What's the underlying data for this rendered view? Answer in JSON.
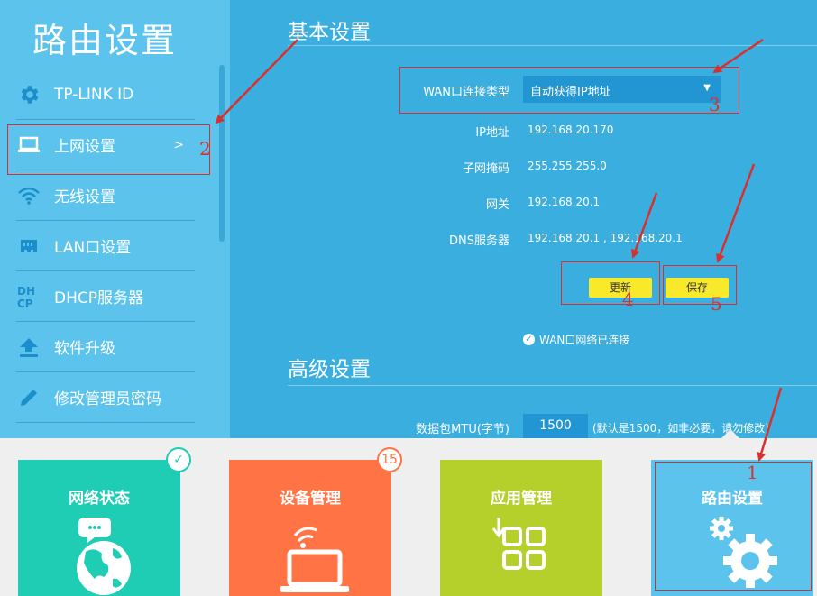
{
  "sidebar": {
    "title": "路由设置",
    "items": [
      {
        "label": "TP-LINK ID",
        "icon": "gear-icon"
      },
      {
        "label": "上网设置",
        "icon": "laptop-icon",
        "chevron": ">"
      },
      {
        "label": "无线设置",
        "icon": "wifi-icon"
      },
      {
        "label": "LAN口设置",
        "icon": "lan-port-icon"
      },
      {
        "label": "DHCP服务器",
        "icon": "dhcp-icon"
      },
      {
        "label": "软件升级",
        "icon": "upload-icon"
      },
      {
        "label": "修改管理员密码",
        "icon": "pencil-icon"
      }
    ]
  },
  "basic": {
    "title": "基本设置",
    "wan_type_label": "WAN口连接类型",
    "wan_type_value": "自动获得IP地址",
    "ip_label": "IP地址",
    "ip_value": "192.168.20.170",
    "mask_label": "子网掩码",
    "mask_value": "255.255.255.0",
    "gateway_label": "网关",
    "gateway_value": "192.168.20.1",
    "dns_label": "DNS服务器",
    "dns_value": "192.168.20.1 , 192.168.20.1",
    "refresh_button": "更新",
    "save_button": "保存",
    "status_text": "WAN口网络已连接"
  },
  "advanced": {
    "title": "高级设置",
    "mtu_label": "数据包MTU(字节)",
    "mtu_value": "1500",
    "mtu_hint": "(默认是1500，如非必要，请勿修改)"
  },
  "tiles": [
    {
      "label": "网络状态",
      "color": "#1ecdb4",
      "badge": "✓"
    },
    {
      "label": "设备管理",
      "color": "#ff7345",
      "badge": "15"
    },
    {
      "label": "应用管理",
      "color": "#b5cf2b"
    },
    {
      "label": "路由设置",
      "color": "#5bc3ec"
    }
  ],
  "annotations": [
    "1",
    "2",
    "3",
    "4",
    "5"
  ],
  "colors": {
    "annotation": "#d9302e",
    "button": "#f8ea2b"
  }
}
